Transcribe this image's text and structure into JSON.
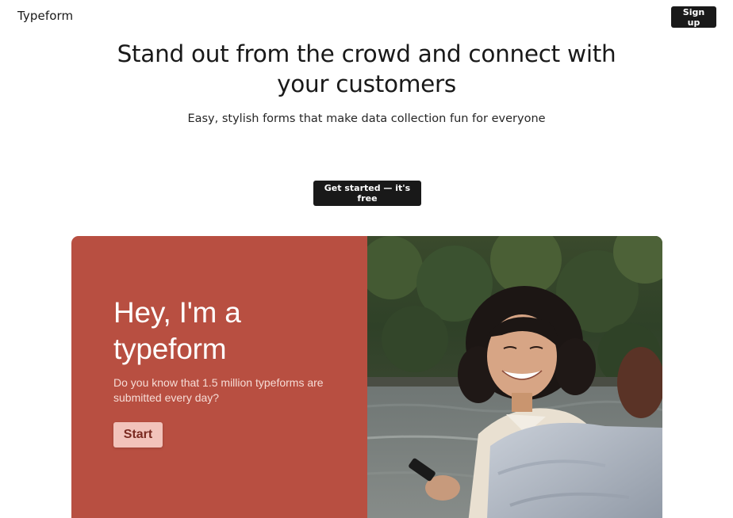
{
  "header": {
    "logo_text": "Typeform",
    "signup_label": "Sign up"
  },
  "hero": {
    "title_line1": "Stand out from the crowd and connect with",
    "title_line2": "your customers",
    "subtitle": "Easy, stylish forms that make data collection fun for everyone",
    "cta_label": "Get started — it's free"
  },
  "demo_form": {
    "heading_line1": "Hey, I'm a",
    "heading_line2": "typeform",
    "question": "Do you know that 1.5 million typeforms are submitted every day?",
    "start_label": "Start",
    "background_color": "#b84f41",
    "button_color": "#f2c3bb"
  },
  "colors": {
    "primary_button": "#191919",
    "text": "#191919"
  }
}
